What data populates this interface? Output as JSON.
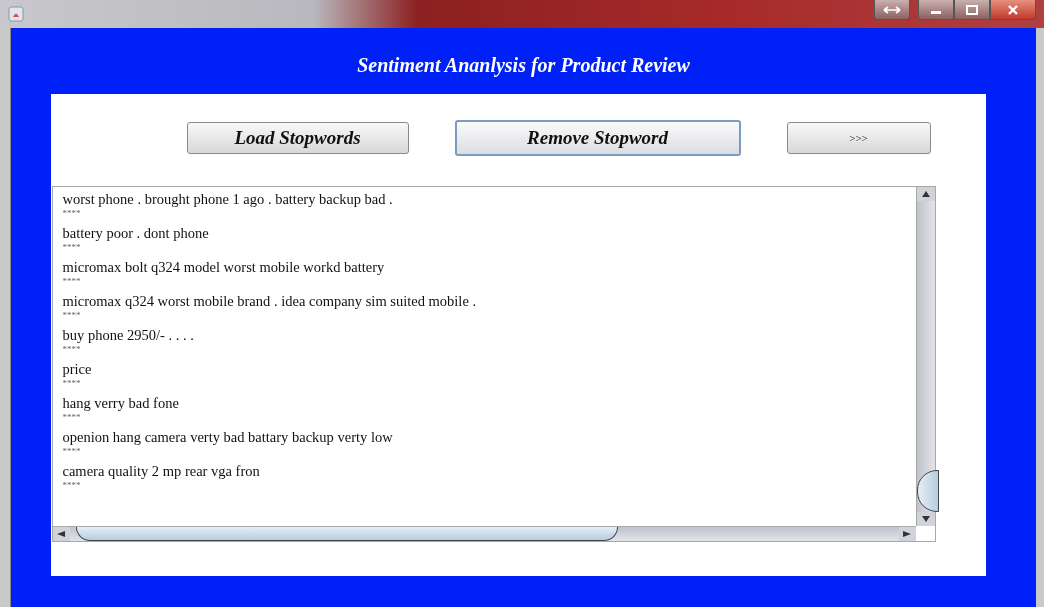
{
  "window": {
    "title": "Sentiment Ananlysis for Product Review"
  },
  "buttons": [
    {
      "label": "Load Stopwords",
      "focused": false,
      "kind": "large"
    },
    {
      "label": "Remove Stopword",
      "focused": true,
      "kind": "large"
    },
    {
      "label": ">>>",
      "focused": false,
      "kind": "small"
    }
  ],
  "reviews": [
    {
      "text": "worst phone .  brought phone 1 ago .  battery backup bad  .",
      "separator": "****"
    },
    {
      "text": "battery poor . dont phone",
      "separator": "****"
    },
    {
      "text": "micromax bolt q324 model worst mobile workd battery",
      "separator": "****"
    },
    {
      "text": "micromax q324 worst mobile brand .  idea company sim suited mobile .",
      "separator": "****"
    },
    {
      "text": "buy phone 2950/-  .  .  .  .",
      "separator": "****"
    },
    {
      "text": "price",
      "separator": "****"
    },
    {
      "text": "hang verry bad fone",
      "separator": "****"
    },
    {
      "text": "openion hang camera verty bad battary backup verty low",
      "separator": "****"
    },
    {
      "text": "camera quality 2 mp rear vga fron",
      "separator": "****"
    }
  ]
}
